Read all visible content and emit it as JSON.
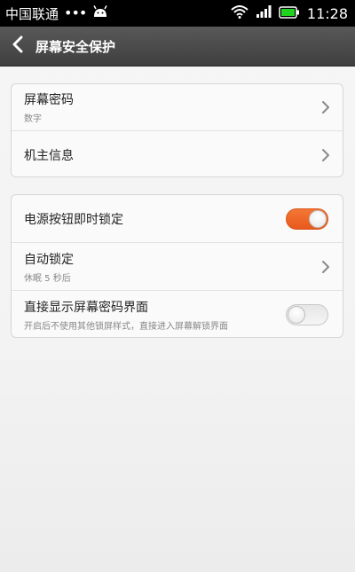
{
  "status_bar": {
    "carrier": "中国联通",
    "dots": "•••",
    "android_icon": "android-icon",
    "wifi_icon": "wifi-icon",
    "signal_icon": "signal-icon",
    "battery_icon": "battery-icon",
    "time": "11:28"
  },
  "header": {
    "back_icon": "back-arrow-icon",
    "title": "屏幕安全保护"
  },
  "group1": [
    {
      "title": "屏幕密码",
      "subtitle": "数字",
      "control": "chevron"
    },
    {
      "title": "机主信息",
      "control": "chevron"
    }
  ],
  "group2": [
    {
      "title": "电源按钮即时锁定",
      "control": "toggle",
      "toggled": true
    },
    {
      "title": "自动锁定",
      "subtitle": "休眠 5 秒后",
      "control": "chevron"
    },
    {
      "title": "直接显示屏幕密码界面",
      "subtitle": "开启后不使用其他锁屏样式，直接进入屏幕解锁界面",
      "control": "toggle",
      "toggled": false
    }
  ],
  "colors": {
    "toggle_on": "#ee6a2a",
    "toggle_off": "#e9e9e9",
    "action_bar": "#4a4a4a",
    "battery": "#1fd31f"
  }
}
